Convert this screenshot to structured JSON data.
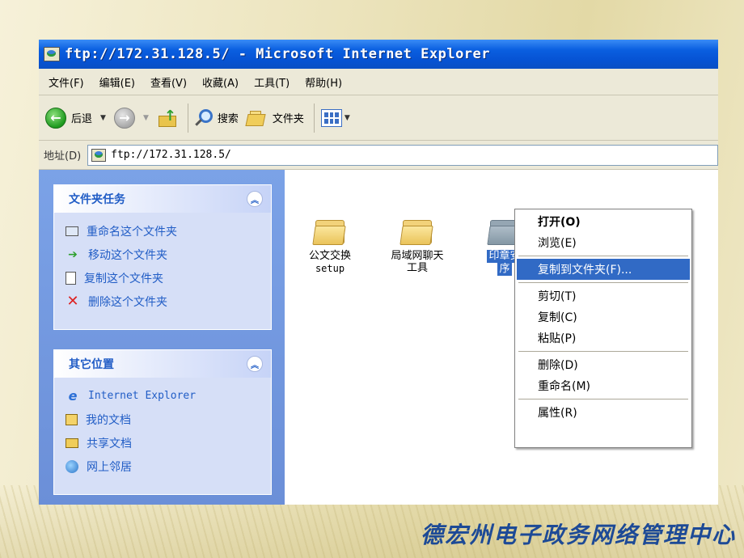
{
  "window": {
    "title": "ftp://172.31.128.5/ - Microsoft Internet Explorer"
  },
  "menubar": {
    "items": [
      "文件(F)",
      "编辑(E)",
      "查看(V)",
      "收藏(A)",
      "工具(T)",
      "帮助(H)"
    ]
  },
  "toolbar": {
    "back_label": "后退",
    "search_label": "搜索",
    "folders_label": "文件夹"
  },
  "address": {
    "label": "地址(D)",
    "value": "ftp://172.31.128.5/"
  },
  "taskpane": {
    "folder_tasks": {
      "title": "文件夹任务",
      "items": [
        "重命名这个文件夹",
        "移动这个文件夹",
        "复制这个文件夹",
        "删除这个文件夹"
      ]
    },
    "other_places": {
      "title": "其它位置",
      "items": [
        "Internet Explorer",
        "我的文档",
        "共享文档",
        "网上邻居"
      ]
    }
  },
  "files": [
    {
      "name": "公文交换",
      "sub": "setup"
    },
    {
      "name": "局域网聊天",
      "sub": "工具"
    },
    {
      "name": "印章安",
      "sub": "序"
    }
  ],
  "context_menu": {
    "items": [
      "打开(O)",
      "浏览(E)",
      "复制到文件夹(F)...",
      "剪切(T)",
      "复制(C)",
      "粘贴(P)",
      "删除(D)",
      "重命名(M)",
      "属性(R)"
    ]
  },
  "footer": {
    "brand": "德宏州电子政务网络管理中心"
  }
}
